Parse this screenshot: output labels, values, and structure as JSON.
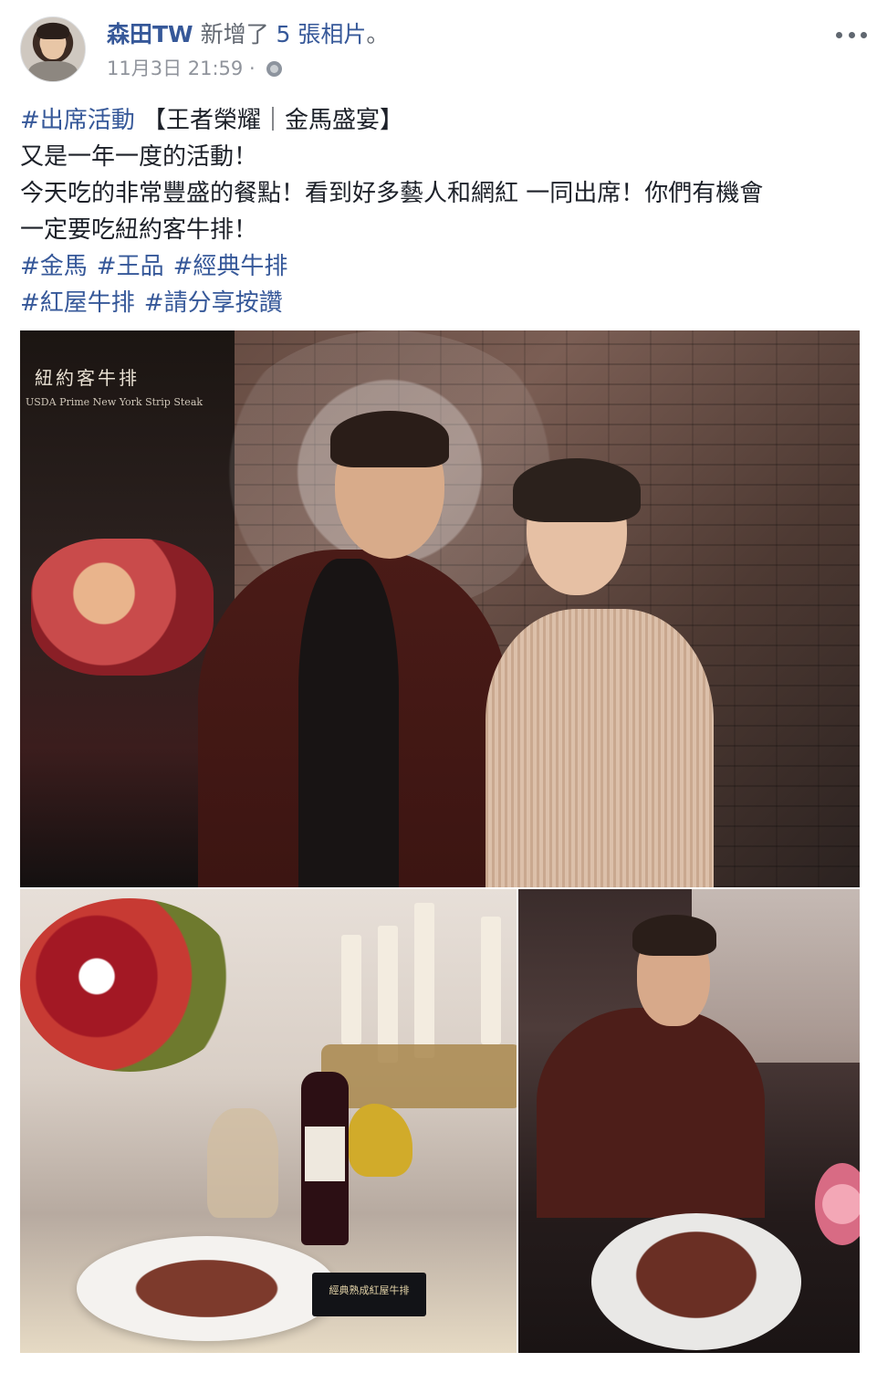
{
  "post": {
    "author": "森田TW",
    "action_text": " 新增了 ",
    "photo_link": "5 張相片",
    "action_end": "。",
    "timestamp": "11月3日 21:59",
    "separator": " · ",
    "privacy_icon": "globe-icon",
    "menu_icon": "more-options-icon"
  },
  "text": {
    "line1_tag": "#出席活動",
    "line1_rest": " 【王者榮耀｜金馬盛宴】",
    "line2": "又是一年一度的活動！",
    "line3": "今天吃的非常豐盛的餐點！看到好多藝人和網紅 一同出席！你們有機會",
    "line4": "一定要吃紐約客牛排！",
    "tags_row1": [
      "#金馬",
      "#王品",
      "#經典牛排"
    ],
    "tags_row2": [
      "#紅屋牛排",
      "#請分享按讚"
    ]
  },
  "photos": {
    "photo1_sign": "紐約客牛排",
    "photo1_sub": "USDA Prime New York Strip Steak",
    "photo2_card": "經典熟成紅屋牛排"
  },
  "colors": {
    "link": "#365899",
    "meta": "#90949c",
    "text": "#1d2129"
  }
}
